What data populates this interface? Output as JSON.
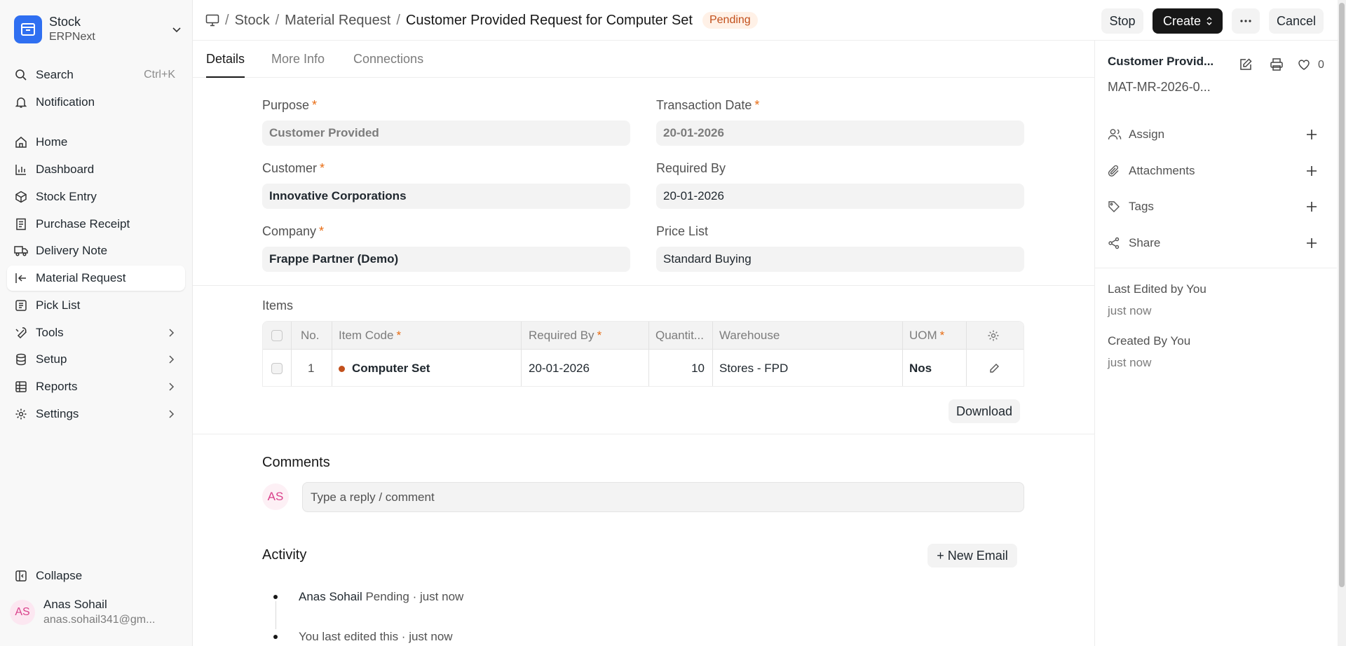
{
  "app": {
    "name": "Stock",
    "sub": "ERPNext"
  },
  "sidebar": {
    "search": {
      "label": "Search",
      "shortcut": "Ctrl+K"
    },
    "notification": "Notification",
    "items": [
      {
        "label": "Home"
      },
      {
        "label": "Dashboard"
      },
      {
        "label": "Stock Entry"
      },
      {
        "label": "Purchase Receipt"
      },
      {
        "label": "Delivery Note"
      },
      {
        "label": "Material Request"
      },
      {
        "label": "Pick List"
      },
      {
        "label": "Tools"
      },
      {
        "label": "Setup"
      },
      {
        "label": "Reports"
      },
      {
        "label": "Settings"
      }
    ],
    "collapse": "Collapse",
    "user": {
      "initials": "AS",
      "name": "Anas Sohail",
      "email": "anas.sohail341@gm..."
    }
  },
  "header": {
    "breadcrumb": [
      "Stock",
      "Material Request",
      "Customer Provided Request for Computer Set"
    ],
    "separator": "/",
    "status": "Pending",
    "buttons": {
      "stop": "Stop",
      "create": "Create",
      "cancel": "Cancel"
    }
  },
  "tabs": [
    "Details",
    "More Info",
    "Connections"
  ],
  "form": {
    "purpose": {
      "label": "Purpose",
      "value": "Customer Provided"
    },
    "transaction_date": {
      "label": "Transaction Date",
      "value": "20-01-2026"
    },
    "customer": {
      "label": "Customer",
      "value": "Innovative Corporations"
    },
    "required_by": {
      "label": "Required By",
      "value": "20-01-2026"
    },
    "company": {
      "label": "Company",
      "value": "Frappe Partner (Demo)"
    },
    "price_list": {
      "label": "Price List",
      "value": "Standard Buying"
    },
    "required_mark": "*"
  },
  "items_table": {
    "title": "Items",
    "columns": [
      "No.",
      "Item Code",
      "Required By",
      "Quantit...",
      "Warehouse",
      "UOM"
    ],
    "rows": [
      {
        "no": "1",
        "item_code": "Computer Set",
        "required_by": "20-01-2026",
        "qty": "10",
        "warehouse": "Stores - FPD",
        "uom": "Nos"
      }
    ],
    "download": "Download"
  },
  "comments": {
    "title": "Comments",
    "initials": "AS",
    "placeholder": "Type a reply / comment"
  },
  "activity": {
    "title": "Activity",
    "new_email": "+ New Email",
    "entries": [
      {
        "who": "Anas Sohail",
        "text": " Pending · just now"
      },
      {
        "who": "",
        "text": "You last edited this · just now"
      }
    ]
  },
  "right_panel": {
    "title": "Customer Provid...",
    "doc_name": "MAT-MR-2026-0...",
    "likes": "0",
    "actions": [
      "Assign",
      "Attachments",
      "Tags",
      "Share"
    ],
    "last_edited": "Last Edited by You",
    "last_edited_time": "just now",
    "created": "Created By You",
    "created_time": "just now"
  }
}
